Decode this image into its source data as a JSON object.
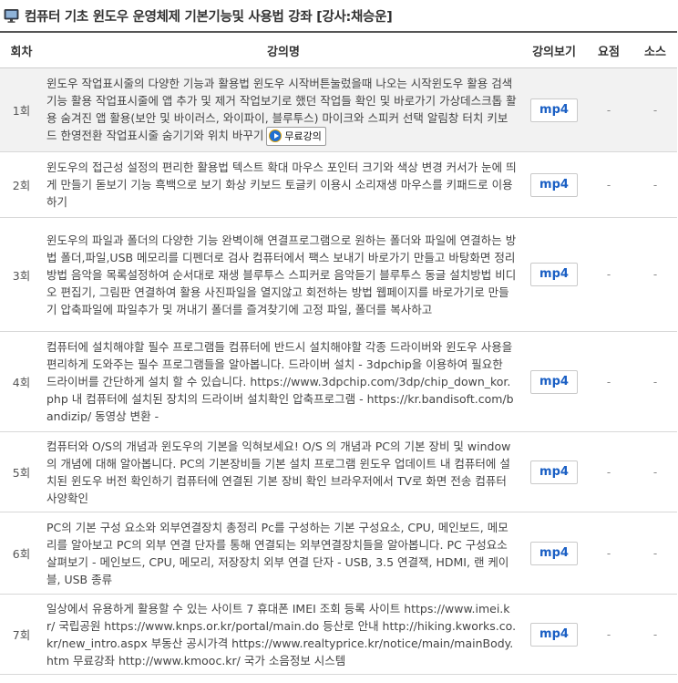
{
  "header": {
    "title": "컴퓨터 기초 윈도우 운영체제 기본기능및 사용법 강좌 [강사:채승운]",
    "icon": "monitor-icon"
  },
  "table": {
    "columns": [
      "회차",
      "강의명",
      "강의보기",
      "요점",
      "소스"
    ],
    "rows": [
      {
        "no": "1회",
        "title": "윈도우 작업표시줄의 다양한 기능과 활용법 윈도우 시작버튼눌렀을때 나오는 시작윈도우 활용 검색기능 활용 작업표시줄에 앱 추가 및 제거 작업보기로 했던 작업들 확인 및 바로가기 가상데스크톱 활용 숨겨진 앱 활용(보안 및 바이러스, 와이파이, 블루투스) 마이크와 스피커 선택 알림창 터치 키보드 한영전환 작업표시줄 숨기기와 위치 바꾸기",
        "badge": "무료강의",
        "view": "mp4",
        "summary": "-",
        "source": "-"
      },
      {
        "no": "2회",
        "title": "윈도우의 접근성 설정의 편리한 활용법 텍스트 확대 마우스 포인터 크기와 색상 변경 커서가 눈에 띄게 만들기 돋보기 기능 흑백으로 보기 화상 키보드 토글키 이용시 소리재생 마우스를 키패드로 이용하기",
        "view": "mp4",
        "summary": "-",
        "source": "-"
      },
      {
        "no": "3회",
        "title": "윈도우의 파일과 폴더의 다양한 기능 완벽이해 연결프로그램으로 원하는 폴더와 파일에 연결하는 방법 폴더,파일,USB 메모리를 디펜더로 검사 컴퓨터에서 팩스 보내기 바로가기 만들고 바탕화면 정리방법 음악을 목록설정하여 순서대로 재생 블루투스 스피커로 음악듣기 블루투스 동글 설치방법 비디오 편집기, 그림판 연결하여 활용 사진파일을 열지않고 회전하는 방법 웹페이지를 바로가기로 만들기 압축파일에 파일추가 및 꺼내기 폴더를 즐겨찾기에 고정 파일, 폴더를 복사하고",
        "view": "mp4",
        "summary": "-",
        "source": "-"
      },
      {
        "no": "4회",
        "title": "컴퓨터에 설치해야할 필수 프로그램들 컴퓨터에 반드시 설치해야할 각종 드라이버와 윈도우 사용을 편리하게 도와주는 필수 프로그램들을 알아봅니다. 드라이버 설치 - 3dpchip을 이용하여 필요한 드라이버를 간단하게 설치 할 수 있습니다. https://www.3dpchip.com/3dp/chip_down_kor.php 내 컴퓨터에 설치된 장치의 드라이버 설치확인 압축프로그램 - https://kr.bandisoft.com/bandizip/ 동영상 변환 -",
        "view": "mp4",
        "summary": "-",
        "source": "-"
      },
      {
        "no": "5회",
        "title": "컴퓨터와 O/S의 개념과 윈도우의 기본을 익혀보세요! O/S 의 개념과 PC의 기본 장비 및 window의 개념에 대해 알아봅니다. PC의 기본장비들 기본 설치 프로그램 윈도우 업데이트 내 컴퓨터에 설치된 윈도우 버전 확인하기 컴퓨터에 연결된 기본 장비 확인 브라우저에서 TV로 화면 전송 컴퓨터 사양확인",
        "view": "mp4",
        "summary": "-",
        "source": "-"
      },
      {
        "no": "6회",
        "title": "PC의 기본 구성 요소와 외부연결장치 총정리 Pc를 구성하는 기본 구성요소, CPU, 메인보드, 메모리를 알아보고 PC의 외부 연결 단자를 통해 연결되는 외부연결장치들을 알아봅니다. PC 구성요소 살펴보기 - 메인보드, CPU, 메모리, 저장장치 외부 연결 단자 - USB, 3.5 연결잭, HDMI, 랜 케이블, USB 종류",
        "view": "mp4",
        "summary": "-",
        "source": "-"
      },
      {
        "no": "7회",
        "title": "일상에서 유용하게 활용할 수 있는 사이트 7 휴대폰 IMEI 조회 등록 사이트 https://www.imei.kr/ 국립공원 https://www.knps.or.kr/portal/main.do 등산로 안내 http://hiking.kworks.co.kr/new_intro.aspx 부동산 공시가격 https://www.realtyprice.kr/notice/main/mainBody.htm 무료강좌 http://www.kmooc.kr/ 국가 소음정보 시스템",
        "view": "mp4",
        "summary": "-",
        "source": "-"
      }
    ]
  }
}
